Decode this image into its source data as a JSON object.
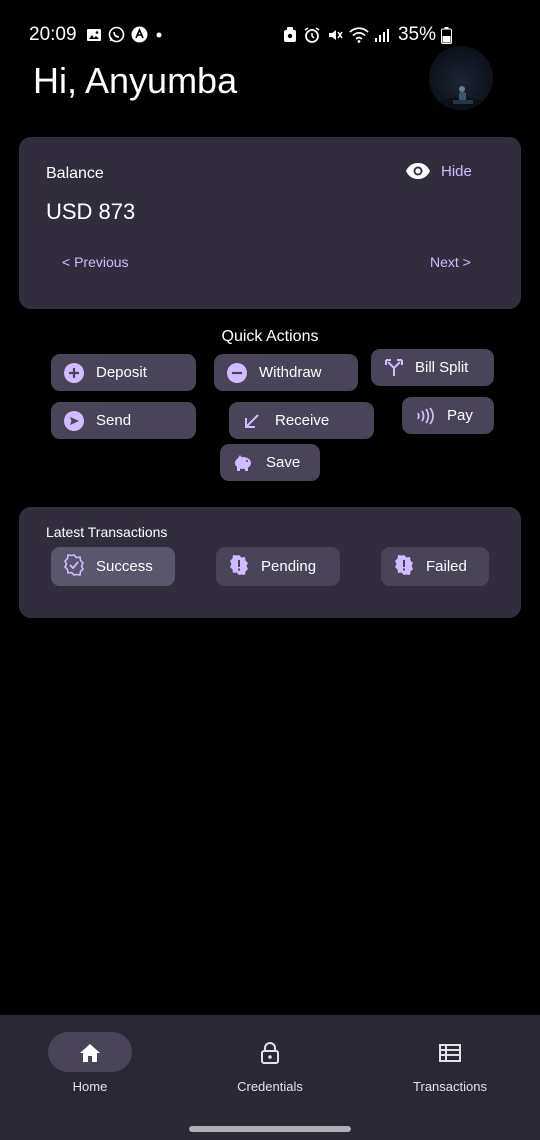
{
  "status_bar": {
    "time": "20:09",
    "battery": "35%",
    "icons": [
      "image-icon",
      "whatsapp-icon",
      "app-icon",
      "dot-icon",
      "wallet-icon",
      "alarm-icon",
      "mute-icon",
      "wifi-icon",
      "signal-icon",
      "battery-icon"
    ]
  },
  "header": {
    "greeting": "Hi, Anyumba"
  },
  "balance": {
    "label": "Balance",
    "value": "USD 873",
    "hide_label": "Hide",
    "previous_label": "< Previous",
    "next_label": "Next >"
  },
  "quick_actions": {
    "title": "Quick Actions",
    "deposit": "Deposit",
    "withdraw": "Withdraw",
    "bill_split": "Bill Split",
    "send": "Send",
    "receive": "Receive",
    "pay": "Pay",
    "save": "Save"
  },
  "transactions": {
    "title": "Latest Transactions",
    "success": "Success",
    "pending": "Pending",
    "failed": "Failed",
    "selected": "Success"
  },
  "bottom_nav": {
    "home": "Home",
    "credentials": "Credentials",
    "transactions": "Transactions",
    "active": "Home"
  },
  "colors": {
    "accent": "#d0bcff",
    "card": "#312d3d",
    "button": "#4a4458",
    "nav_bar": "#2b2836",
    "background": "#000000"
  }
}
